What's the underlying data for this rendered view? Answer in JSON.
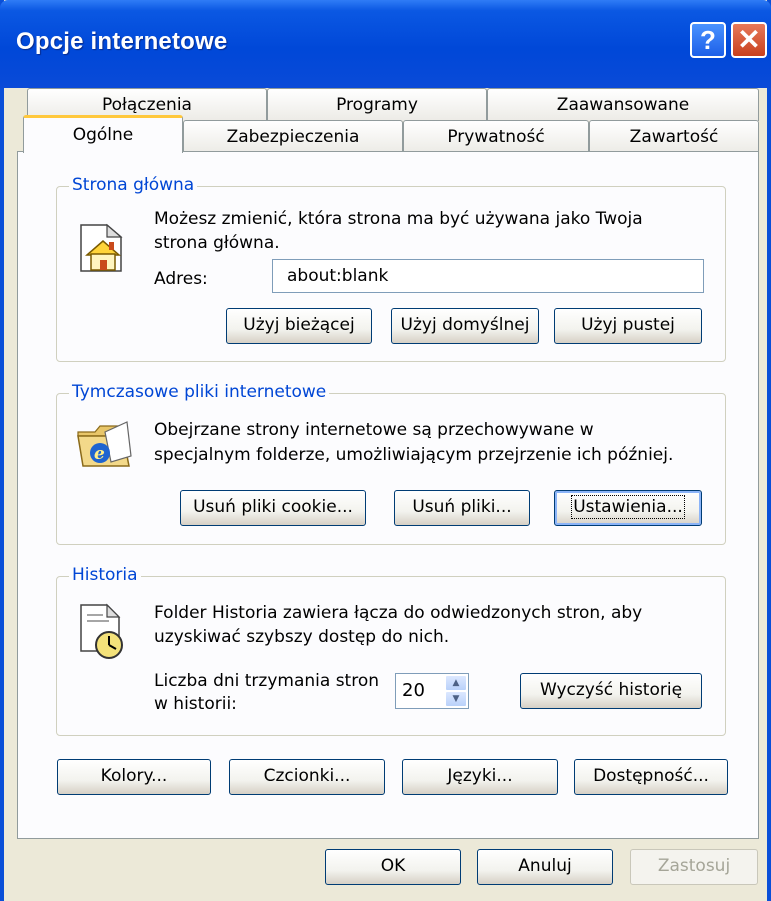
{
  "window": {
    "title": "Opcje internetowe"
  },
  "titlebar": {
    "help_glyph": "?",
    "close_glyph": "✕"
  },
  "tabs": {
    "row1": [
      "Połączenia",
      "Programy",
      "Zaawansowane"
    ],
    "row2": [
      "Ogólne",
      "Zabezpieczenia",
      "Prywatność",
      "Zawartość"
    ],
    "active": "Ogólne"
  },
  "home": {
    "title": "Strona główna",
    "desc1": "Możesz zmienić, która strona ma być używana jako Twoja",
    "desc2": "strona główna.",
    "address_label": "Adres:",
    "address_value": "about:blank",
    "use_current": "Użyj bieżącej",
    "use_default": "Użyj domyślnej",
    "use_blank": "Użyj pustej"
  },
  "temp": {
    "title": "Tymczasowe pliki internetowe",
    "desc1": "Obejrzane strony internetowe są przechowywane w",
    "desc2": "specjalnym folderze, umożliwiającym przejrzenie ich później.",
    "delete_cookies": "Usuń pliki cookie...",
    "delete_files": "Usuń pliki...",
    "settings": "Ustawienia..."
  },
  "history": {
    "title": "Historia",
    "desc1": "Folder Historia zawiera łącza do odwiedzonych stron, aby",
    "desc2": "uzyskiwać szybszy dostęp do nich.",
    "days_label1": "Liczba dni trzymania stron",
    "days_label2": "w historii:",
    "days_value": "20",
    "clear": "Wyczyść historię"
  },
  "bottom_row": {
    "colors": "Kolory...",
    "fonts": "Czcionki...",
    "languages": "Języki...",
    "accessibility": "Dostępność..."
  },
  "dialog": {
    "ok": "OK",
    "cancel": "Anuluj",
    "apply": "Zastosuj"
  },
  "icons": [
    "home-page-icon",
    "temporary-files-folder-icon",
    "history-clock-icon",
    "help-icon",
    "close-icon",
    "spin-up-icon",
    "spin-down-icon"
  ],
  "colors": {
    "titlebar": "#0048d8",
    "dialog_bg": "#ece9d8",
    "group_title": "#0046d5",
    "active_tab_accent": "#ffc83c"
  }
}
